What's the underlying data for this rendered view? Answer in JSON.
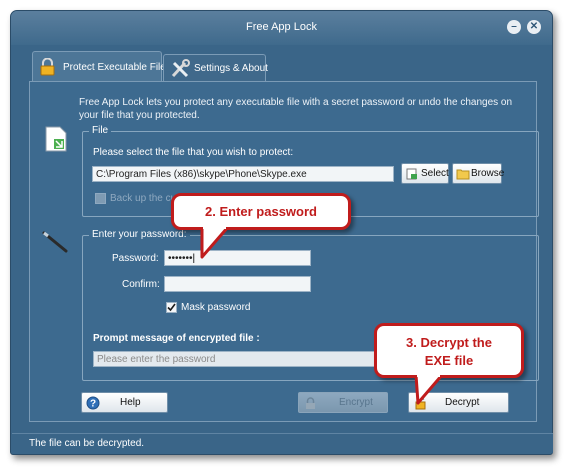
{
  "window": {
    "title": "Free App Lock"
  },
  "tabs": [
    {
      "label": "Protect Executable File",
      "active": true
    },
    {
      "label": "Settings & About",
      "active": false
    }
  ],
  "description": "Free App Lock lets you protect any executable file with a secret password or undo the changes on your file that you protected.",
  "file_group": {
    "title": "File",
    "prompt": "Please select the file that you wish to protect:",
    "path_value": "C:\\Program Files (x86)\\skype\\Phone\\Skype.exe",
    "select_label": "Select",
    "browse_label": "Browse",
    "backup_label": "Back up the curr"
  },
  "password_group": {
    "title": "Enter your password:",
    "password_label": "Password:",
    "password_value": "•••••••",
    "confirm_label": "Confirm:",
    "confirm_value": "",
    "mask_label": "Mask password",
    "mask_checked": true,
    "prompt_label": "Prompt message of encrypted file :",
    "prompt_placeholder": "Please enter the password"
  },
  "buttons": {
    "help": "Help",
    "encrypt": "Encrypt",
    "decrypt": "Decrypt"
  },
  "status": "The file can be decrypted.",
  "callouts": {
    "step2": "2. Enter password",
    "step3_line1": "3. Decrypt the",
    "step3_line2": "EXE file"
  },
  "colors": {
    "window_bg": "#3a6588",
    "callout_border": "#c01c1c"
  }
}
